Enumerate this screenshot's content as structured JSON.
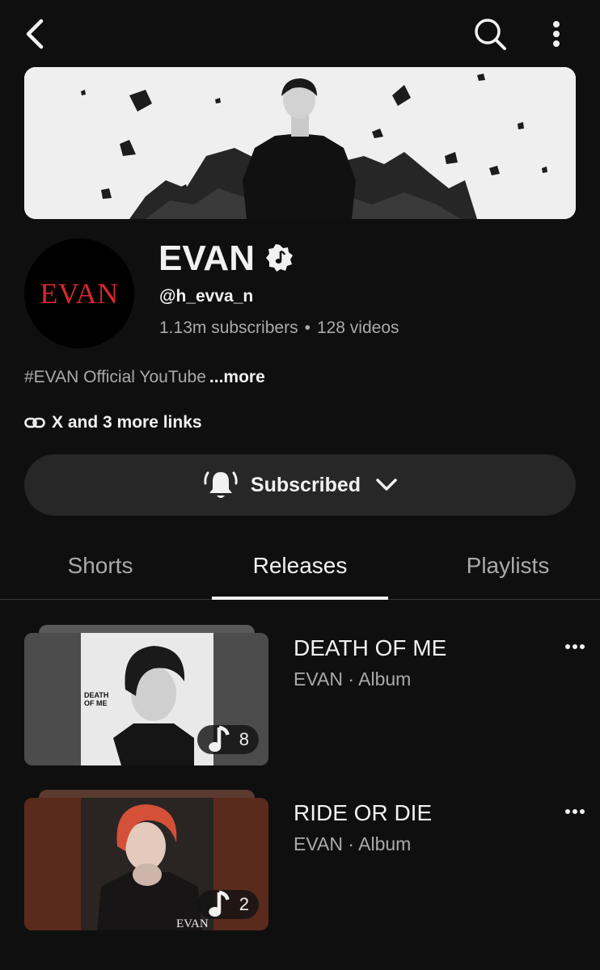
{
  "channel": {
    "name": "EVAN",
    "avatar_text": "EVAN",
    "handle": "@h_evva_n",
    "subscribers": "1.13m subscribers",
    "separator": "•",
    "videos": "128 videos",
    "description": "#EVAN Official YouTube",
    "more_label": "...more",
    "links_label": "X and 3 more links"
  },
  "subscribe": {
    "label": "Subscribed"
  },
  "tabs": [
    {
      "label": "Shorts",
      "active": false
    },
    {
      "label": "Releases",
      "active": true
    },
    {
      "label": "Playlists",
      "active": false
    }
  ],
  "releases": [
    {
      "title": "DEATH OF ME",
      "artist": "EVAN",
      "sep": "·",
      "type": "Album",
      "track_count": "8",
      "cover_text_1": "DEATH",
      "cover_text_2": "OF ME"
    },
    {
      "title": "RIDE OR DIE",
      "artist": "EVAN",
      "sep": "·",
      "type": "Album",
      "track_count": "2",
      "cover_text": "EVAN"
    }
  ],
  "icons": {
    "back": "back-arrow-icon",
    "search": "search-icon",
    "more": "more-vert-icon",
    "verified": "verified-music-icon",
    "link": "link-icon",
    "bell": "bell-ringing-icon",
    "chevron": "chevron-down-icon",
    "music_note": "music-note-icon",
    "item_menu": "more-horiz-icon"
  },
  "colors": {
    "background": "#0f0f0f",
    "text_primary": "#f1f1f1",
    "text_secondary": "#aaaaaa",
    "button_bg": "#272727",
    "avatar_logo": "#d6282d"
  }
}
